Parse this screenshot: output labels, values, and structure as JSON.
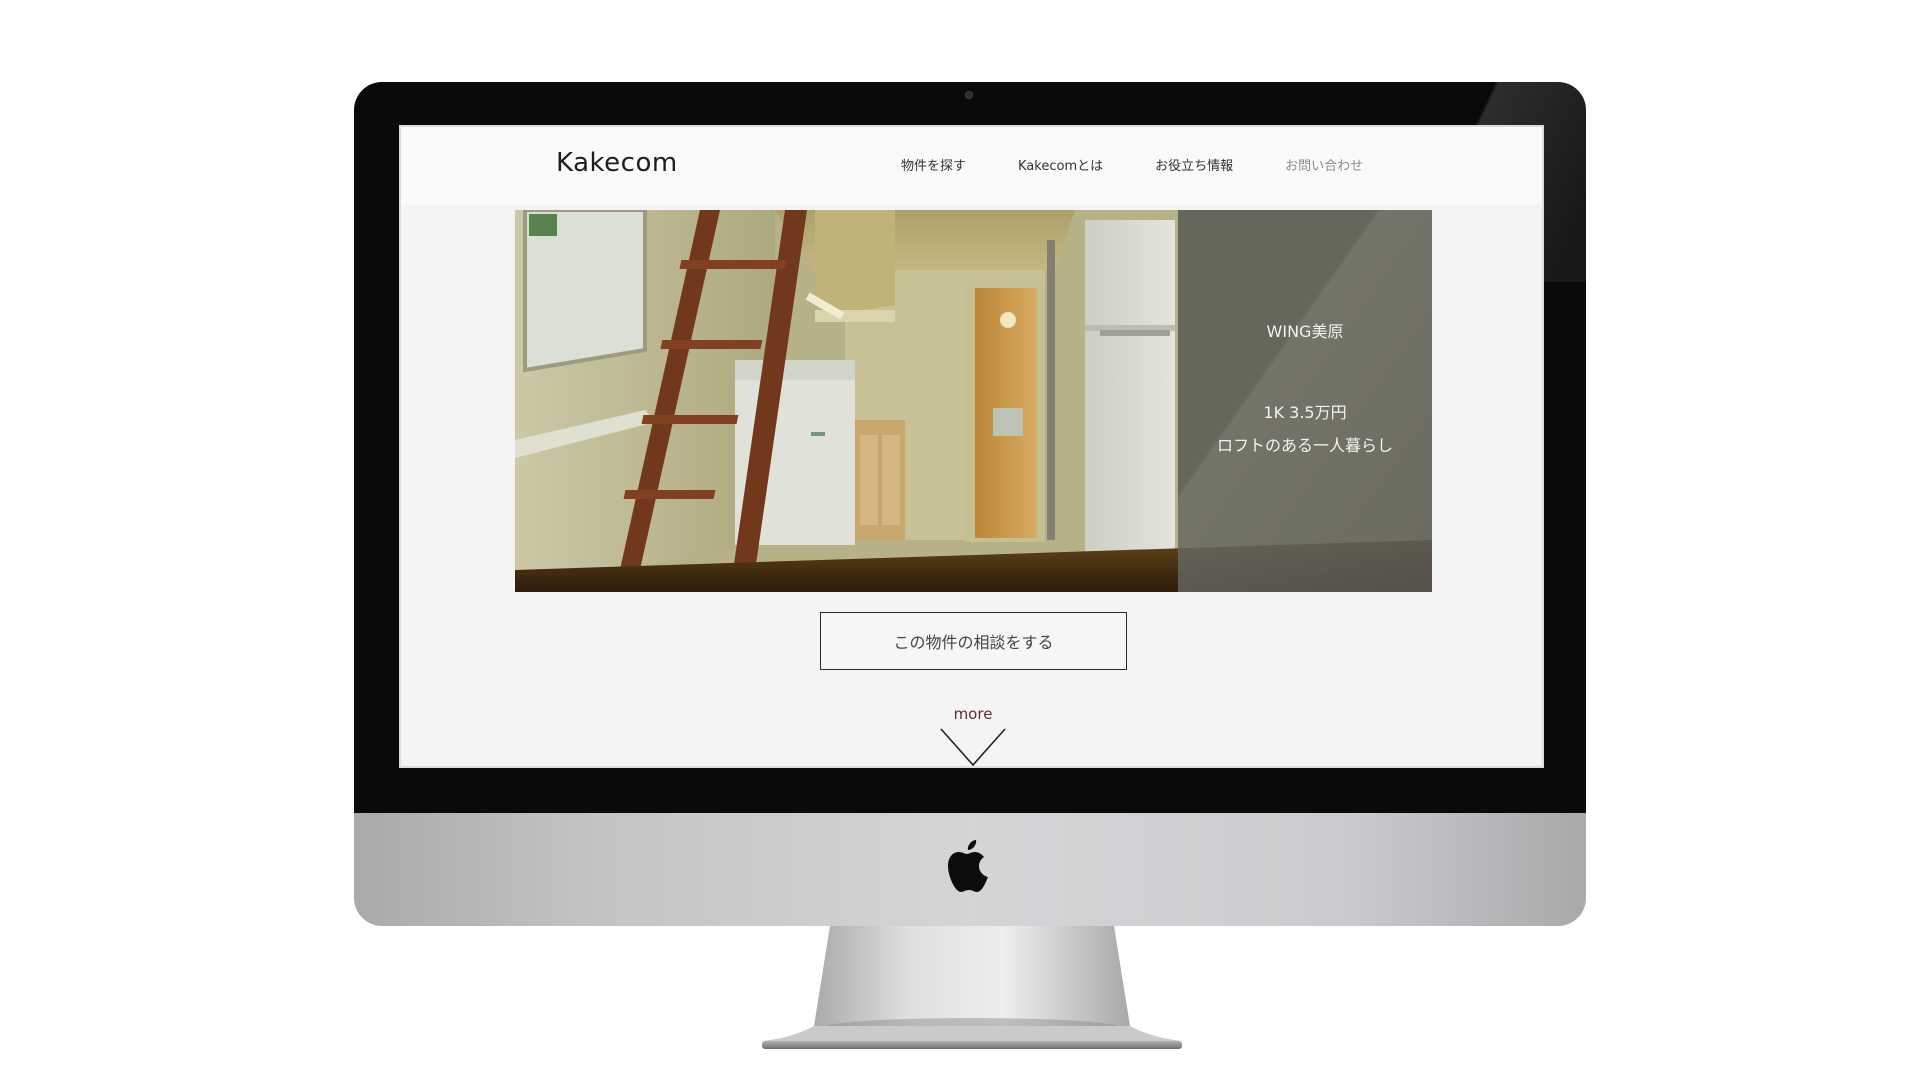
{
  "site": {
    "logo": "Kakecom",
    "nav": [
      {
        "label": "物件を探す"
      },
      {
        "label": "Kakecomとは"
      },
      {
        "label": "お役立ち情報"
      },
      {
        "label": "お問い合わせ"
      }
    ]
  },
  "hero": {
    "property_name": "WING美原",
    "price": "1K 3.5万円",
    "description": "ロフトのある一人暮らし"
  },
  "cta": {
    "consult_label": "この物件の相談をする"
  },
  "more": {
    "label": "more"
  },
  "icons": {
    "brand_logo": "apple-logo-icon",
    "more_arrow": "chevron-down-icon"
  },
  "colors": {
    "bezel": "#0a0a0a",
    "screen_bg": "#f4f4f4",
    "overlay": "#55554f",
    "more_text": "#5a2f2f"
  }
}
